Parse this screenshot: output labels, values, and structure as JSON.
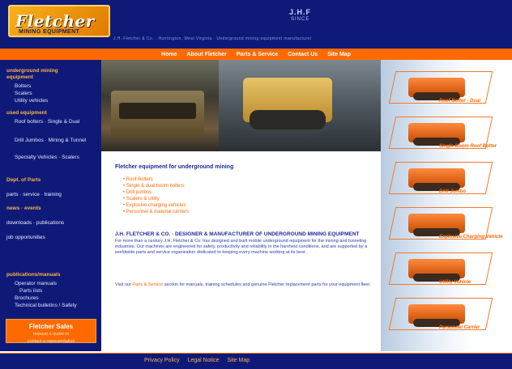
{
  "header": {
    "logo_text": "Fletcher",
    "logo_sub": "MINING EQUIPMENT",
    "mark_line1": "J.H.F",
    "mark_line2": "SINCE",
    "tagline": "J.H. Fletcher & Co. · Huntington, West Virginia · Underground mining equipment manufacturer"
  },
  "top_nav": [
    "Home",
    "About Fletcher",
    "Parts & Service",
    "Contact Us",
    "Site Map"
  ],
  "sidebar": {
    "section1_title": "underground mining",
    "section1_sub": "equipment",
    "items1": [
      "Bolters",
      "Scalers",
      "Utility vehicles"
    ],
    "section2_title": "used equipment",
    "items2": [
      "Roof bolters · Single & Dual",
      "Drill Jumbos · Mining & Tunnel",
      "Specialty Vehicles · Scalers"
    ],
    "links": [
      "Dept. of Parts",
      "parts · service · training",
      "news · events",
      "downloads · publications",
      "job opportunities"
    ],
    "section3_title": "publications/manuals",
    "items3": [
      "Operator manuals",
      "Parts lists",
      "Brochures",
      "Technical bulletins / Safety"
    ],
    "quote_title": "Fletcher Sales",
    "quote_sub1": "request a quote or",
    "quote_sub2": "contact a representative"
  },
  "main": {
    "intro_title": "Fletcher equipment for underground mining",
    "bullets": [
      "Roof Bolters",
      "Single & dual boom bolters",
      "Drill jumbos",
      "Scalers & utility",
      "Explosive charging vehicles",
      "Personnel & material carriers"
    ],
    "para_title": "J.H. FLETCHER & CO. · DESIGNER & MANUFACTURER OF UNDERGROUND MINING EQUIPMENT",
    "para": "For more than a century J.H. Fletcher & Co. has designed and built mobile underground equipment for the mining and tunneling industries. Our machines are engineered for safety, productivity and reliability in the harshest conditions, and are supported by a worldwide parts and service organization dedicated to keeping every machine working at its best.",
    "link_text_pre": "Visit our",
    "link_text_hl": "Parts & Service",
    "link_text_post": "section for manuals, training schedules and genuine Fletcher replacement parts for your equipment fleet."
  },
  "gallery": [
    "Roof Bolter · Dual",
    "Single Boom Roof Bolter",
    "Drill Jumbo",
    "Explosive Charging Vehicle",
    "Utility Vehicle",
    "Personnel Carrier"
  ],
  "footer": {
    "links": [
      "Privacy Policy",
      "Legal Notice",
      "Site Map"
    ]
  }
}
